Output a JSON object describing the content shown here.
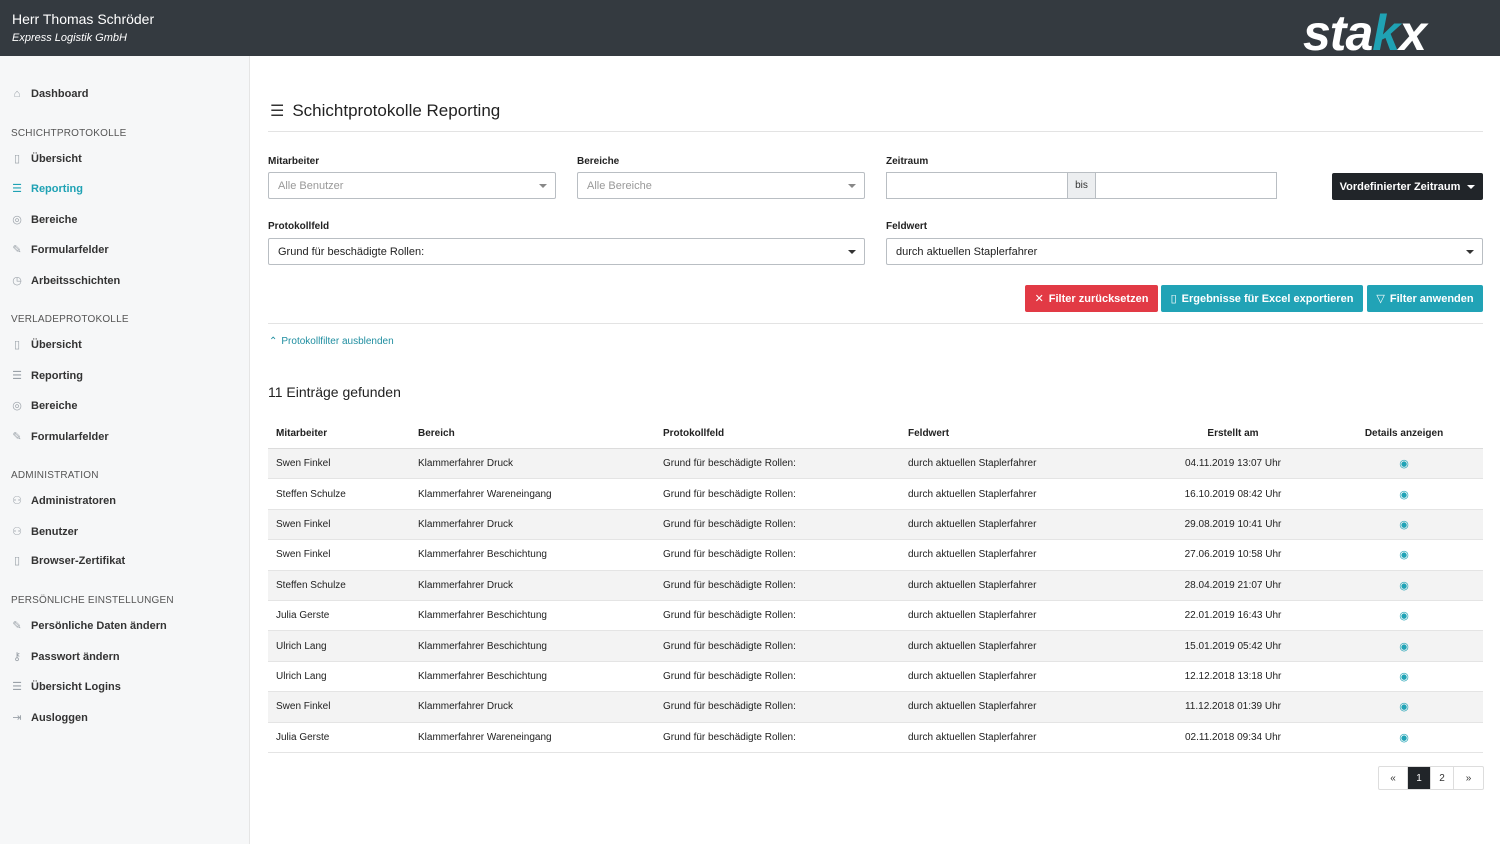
{
  "header": {
    "user_name": "Herr Thomas Schröder",
    "company": "Express Logistik GmbH",
    "logo_a": "sta",
    "logo_k": "k",
    "logo_b": "x"
  },
  "sidebar": {
    "dashboard": "Dashboard",
    "sections": [
      {
        "title": "SCHICHTPROTOKOLLE",
        "items": [
          "Übersicht",
          "Reporting",
          "Bereiche",
          "Formularfelder",
          "Arbeitsschichten"
        ]
      },
      {
        "title": "VERLADEPROTOKOLLE",
        "items": [
          "Übersicht",
          "Reporting",
          "Bereiche",
          "Formularfelder"
        ]
      },
      {
        "title": "ADMINISTRATION",
        "items": [
          "Administratoren",
          "Benutzer",
          "Browser-Zertifikat"
        ]
      },
      {
        "title": "PERSÖNLICHE EINSTELLUNGEN",
        "items": [
          "Persönliche Daten ändern",
          "Passwort ändern",
          "Übersicht Logins",
          "Ausloggen"
        ]
      }
    ]
  },
  "page": {
    "title": "Schichtprotokolle Reporting"
  },
  "filters": {
    "mitarbeiter_label": "Mitarbeiter",
    "mitarbeiter_placeholder": "Alle Benutzer",
    "bereiche_label": "Bereiche",
    "bereiche_placeholder": "Alle Bereiche",
    "zeitraum_label": "Zeitraum",
    "bis": "bis",
    "predefined_button": "Vordefinierter Zeitraum",
    "protokollfeld_label": "Protokollfeld",
    "protokollfeld_value": "Grund für beschädigte Rollen:",
    "feldwert_label": "Feldwert",
    "feldwert_value": "durch aktuellen Staplerfahrer",
    "reset_button": "Filter zurücksetzen",
    "export_button": "Ergebnisse für Excel exportieren",
    "apply_button": "Filter anwenden",
    "toggle_link": "Protokollfilter ausblenden"
  },
  "results": {
    "count_text": "11 Einträge gefunden",
    "columns": [
      "Mitarbeiter",
      "Bereich",
      "Protokollfeld",
      "Feldwert",
      "Erstellt am",
      "Details anzeigen"
    ],
    "rows": [
      [
        "Swen Finkel",
        "Klammerfahrer Druck",
        "Grund für beschädigte Rollen:",
        "durch aktuellen Staplerfahrer",
        "04.11.2019 13:07 Uhr"
      ],
      [
        "Steffen Schulze",
        "Klammerfahrer Wareneingang",
        "Grund für beschädigte Rollen:",
        "durch aktuellen Staplerfahrer",
        "16.10.2019 08:42 Uhr"
      ],
      [
        "Swen Finkel",
        "Klammerfahrer Druck",
        "Grund für beschädigte Rollen:",
        "durch aktuellen Staplerfahrer",
        "29.08.2019 10:41 Uhr"
      ],
      [
        "Swen Finkel",
        "Klammerfahrer Beschichtung",
        "Grund für beschädigte Rollen:",
        "durch aktuellen Staplerfahrer",
        "27.06.2019 10:58 Uhr"
      ],
      [
        "Steffen Schulze",
        "Klammerfahrer Druck",
        "Grund für beschädigte Rollen:",
        "durch aktuellen Staplerfahrer",
        "28.04.2019 21:07 Uhr"
      ],
      [
        "Julia Gerste",
        "Klammerfahrer Beschichtung",
        "Grund für beschädigte Rollen:",
        "durch aktuellen Staplerfahrer",
        "22.01.2019 16:43 Uhr"
      ],
      [
        "Ulrich Lang",
        "Klammerfahrer Beschichtung",
        "Grund für beschädigte Rollen:",
        "durch aktuellen Staplerfahrer",
        "15.01.2019 05:42 Uhr"
      ],
      [
        "Ulrich Lang",
        "Klammerfahrer Beschichtung",
        "Grund für beschädigte Rollen:",
        "durch aktuellen Staplerfahrer",
        "12.12.2018 13:18 Uhr"
      ],
      [
        "Swen Finkel",
        "Klammerfahrer Druck",
        "Grund für beschädigte Rollen:",
        "durch aktuellen Staplerfahrer",
        "11.12.2018 01:39 Uhr"
      ],
      [
        "Julia Gerste",
        "Klammerfahrer Wareneingang",
        "Grund für beschädigte Rollen:",
        "durch aktuellen Staplerfahrer",
        "02.11.2018 09:34 Uhr"
      ]
    ]
  },
  "pagination": {
    "prev": "«",
    "pages": [
      "1",
      "2"
    ],
    "current": "1",
    "next": "»"
  },
  "colors": {
    "accent": "#1fa2b4",
    "danger": "#e23a45",
    "header_bg": "#343a40",
    "dark_button": "#212529"
  }
}
